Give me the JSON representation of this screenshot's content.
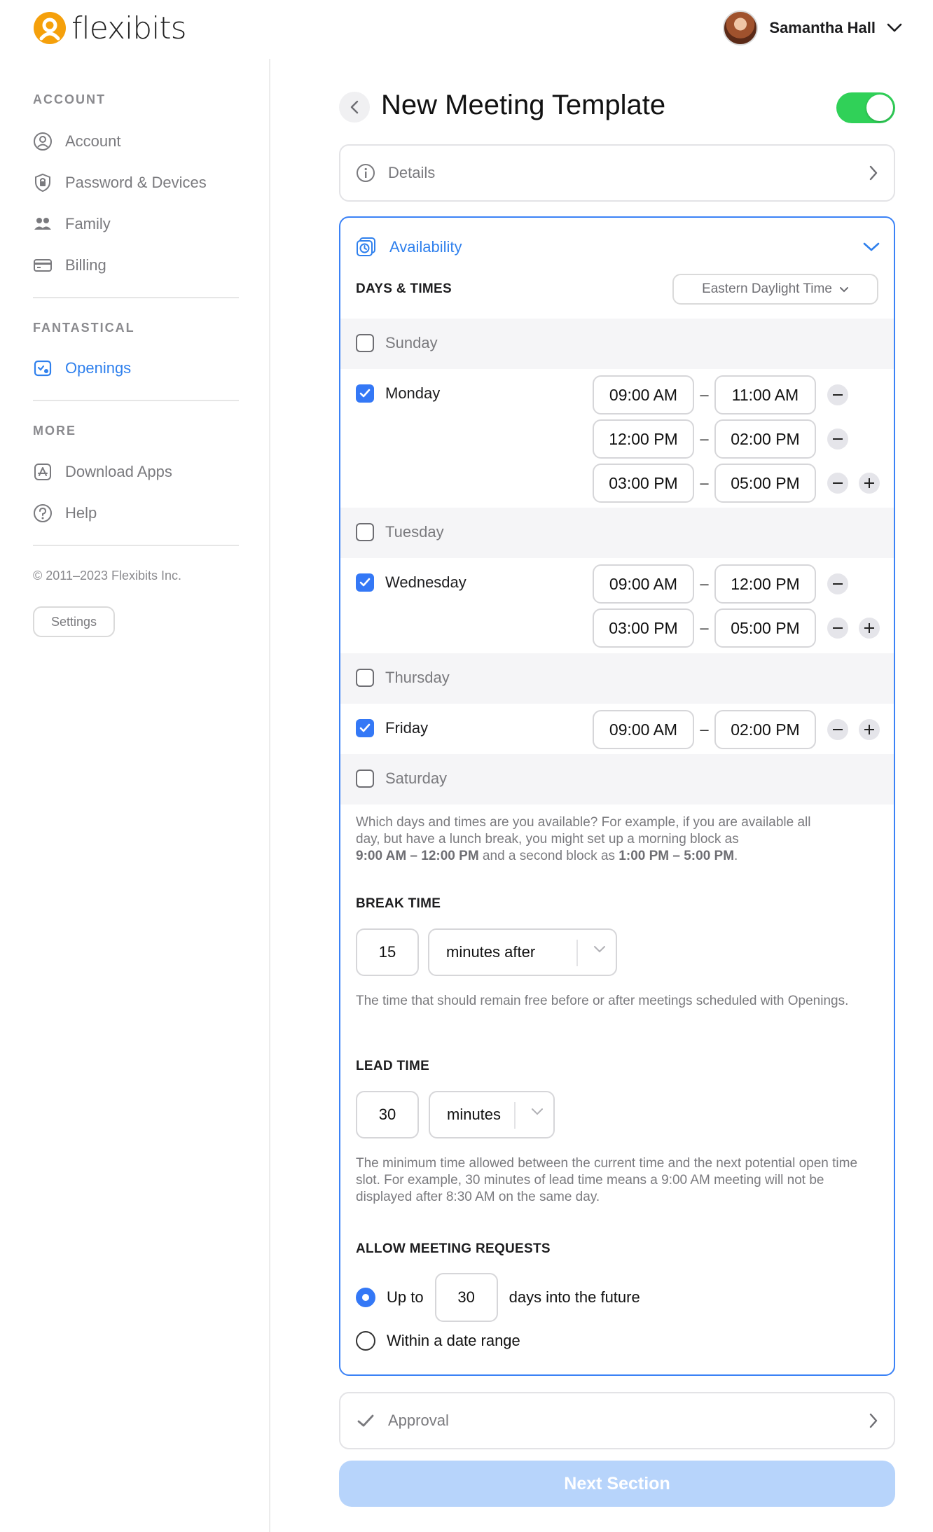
{
  "brand": {
    "name": "flexibits"
  },
  "user": {
    "name": "Samantha Hall"
  },
  "sidebar": {
    "sections": [
      {
        "title": "ACCOUNT",
        "items": [
          {
            "label": "Account",
            "icon": "user-circle-icon"
          },
          {
            "label": "Password & Devices",
            "icon": "shield-lock-icon"
          },
          {
            "label": "Family",
            "icon": "family-icon"
          },
          {
            "label": "Billing",
            "icon": "credit-card-icon"
          }
        ]
      },
      {
        "title": "FANTASTICAL",
        "items": [
          {
            "label": "Openings",
            "icon": "openings-icon",
            "active": true
          }
        ]
      },
      {
        "title": "MORE",
        "items": [
          {
            "label": "Download Apps",
            "icon": "app-store-icon"
          },
          {
            "label": "Help",
            "icon": "question-icon"
          }
        ]
      }
    ],
    "copyright": "© 2011–2023 Flexibits Inc.",
    "settings_label": "Settings"
  },
  "page": {
    "title": "New Meeting Template",
    "enabled": true
  },
  "details": {
    "label": "Details"
  },
  "availability": {
    "label": "Availability",
    "days_times_title": "DAYS & TIMES",
    "timezone": "Eastern Daylight Time",
    "days": [
      {
        "name": "Sunday",
        "enabled": false,
        "slots": []
      },
      {
        "name": "Monday",
        "enabled": true,
        "slots": [
          {
            "start": "09:00 AM",
            "end": "11:00 AM"
          },
          {
            "start": "12:00 PM",
            "end": "02:00 PM"
          },
          {
            "start": "03:00 PM",
            "end": "05:00 PM"
          }
        ]
      },
      {
        "name": "Tuesday",
        "enabled": false,
        "slots": []
      },
      {
        "name": "Wednesday",
        "enabled": true,
        "slots": [
          {
            "start": "09:00 AM",
            "end": "12:00 PM"
          },
          {
            "start": "03:00 PM",
            "end": "05:00 PM"
          }
        ]
      },
      {
        "name": "Thursday",
        "enabled": false,
        "slots": []
      },
      {
        "name": "Friday",
        "enabled": true,
        "slots": [
          {
            "start": "09:00 AM",
            "end": "02:00 PM"
          }
        ]
      },
      {
        "name": "Saturday",
        "enabled": false,
        "slots": []
      }
    ],
    "days_help": {
      "line1": "Which days and times are you available? For example, if you are available all",
      "line2": "day, but have a lunch break, you might set up a morning block as",
      "block1": "9:00 AM – 12:00 PM",
      "mid": " and a second block as ",
      "block2": "1:00 PM – 5:00 PM",
      "end": "."
    },
    "break_time": {
      "title": "BREAK TIME",
      "value": "15",
      "unit": "minutes after",
      "help": "The time that should remain free before or after meetings scheduled with Openings."
    },
    "lead_time": {
      "title": "LEAD TIME",
      "value": "30",
      "unit": "minutes",
      "help": "The minimum time allowed between the current time and the next potential open time slot. For example, 30 minutes of lead time means a 9:00 AM meeting will not be displayed after 8:30 AM on the same day."
    },
    "meeting_requests": {
      "title": "ALLOW MEETING REQUESTS",
      "option1_prefix": "Up to",
      "option1_value": "30",
      "option1_suffix": "days into the future",
      "option2": "Within a date range",
      "selected": "option1"
    }
  },
  "approval": {
    "label": "Approval"
  },
  "next_button": "Next Section",
  "colors": {
    "accent": "#2f80ed",
    "toggle_on": "#30d158",
    "checkbox": "#3478f6",
    "next_disabled": "#b7d4fb",
    "logo": "#f5a00b"
  }
}
